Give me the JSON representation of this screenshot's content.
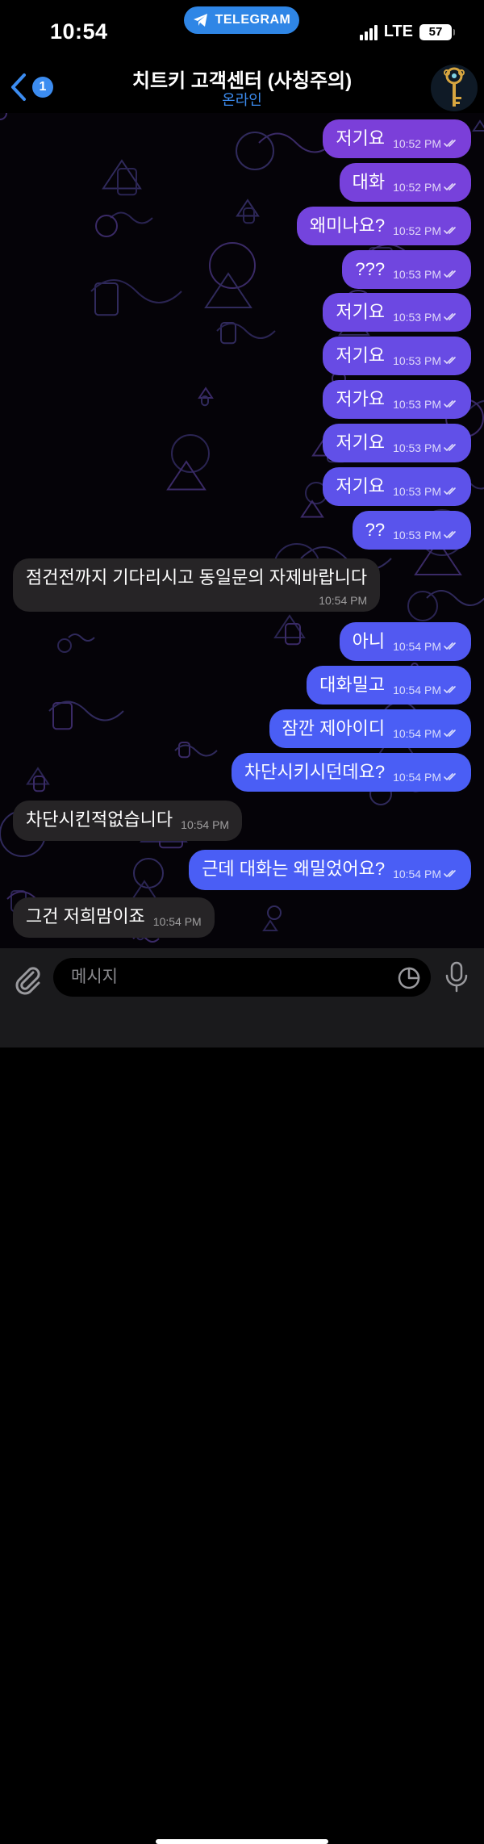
{
  "status_bar": {
    "time": "10:54",
    "pill_label": "TELEGRAM",
    "network": "LTE",
    "battery": "57"
  },
  "header": {
    "back_count": "1",
    "title": "치트키 고객센터 (사칭주의)",
    "subtitle": "온라인"
  },
  "colors": {
    "accent": "#3c8cf0",
    "incoming_bubble": "#262426",
    "outgoing_purple": "#7b3fd9",
    "outgoing_blue": "#4a5ef5"
  },
  "messages": [
    {
      "dir": "out",
      "text": "저기요",
      "time": "10:52 PM",
      "read": true
    },
    {
      "dir": "out",
      "text": "대화",
      "time": "10:52 PM",
      "read": true
    },
    {
      "dir": "out",
      "text": "왜미나요?",
      "time": "10:52 PM",
      "read": true
    },
    {
      "dir": "out",
      "text": "???",
      "time": "10:53 PM",
      "read": true
    },
    {
      "dir": "out",
      "text": "저기요",
      "time": "10:53 PM",
      "read": true
    },
    {
      "dir": "out",
      "text": "저기요",
      "time": "10:53 PM",
      "read": true
    },
    {
      "dir": "out",
      "text": "저가요",
      "time": "10:53 PM",
      "read": true
    },
    {
      "dir": "out",
      "text": "저기요",
      "time": "10:53 PM",
      "read": true
    },
    {
      "dir": "out",
      "text": "저기요",
      "time": "10:53 PM",
      "read": true
    },
    {
      "dir": "out",
      "text": "??",
      "time": "10:53 PM",
      "read": true
    },
    {
      "dir": "in",
      "text": "점건전까지 기다리시고 동일문의 자제바랍니다",
      "time": "10:54 PM"
    },
    {
      "dir": "out",
      "text": "아니",
      "time": "10:54 PM",
      "read": true
    },
    {
      "dir": "out",
      "text": "대화밀고",
      "time": "10:54 PM",
      "read": true
    },
    {
      "dir": "out",
      "text": "잠깐 제아이디",
      "time": "10:54 PM",
      "read": true
    },
    {
      "dir": "out",
      "text": "차단시키시던데요?",
      "time": "10:54 PM",
      "read": true
    },
    {
      "dir": "in",
      "text": "차단시킨적없습니다",
      "time": "10:54 PM"
    },
    {
      "dir": "out",
      "text": "근데 대화는 왜밀었어요?",
      "time": "10:54 PM",
      "read": true
    },
    {
      "dir": "in",
      "text": "그건 저희맘이죠",
      "time": "10:54 PM"
    }
  ],
  "input": {
    "placeholder": "메시지"
  },
  "icons": {
    "back": "chevron-left-icon",
    "avatar": "key-icon",
    "attach": "paperclip-icon",
    "sticker": "sticker-icon",
    "mic": "microphone-icon",
    "read_receipt": "double-check-icon"
  }
}
